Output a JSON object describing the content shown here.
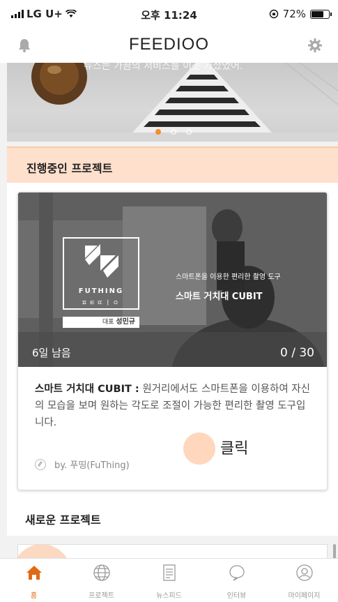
{
  "status_bar": {
    "carrier": "LG U+",
    "time": "오후 11:24",
    "battery_text": "72%",
    "battery_level": 0.72
  },
  "header": {
    "title": "FEEDIOO",
    "left_icon": "bell-icon",
    "right_icon": "gear-icon"
  },
  "banner": {
    "caption": "뉴스는 가끔의 서비스를 이곳 가셨었어.",
    "slide_count": 3,
    "active_slide": 0
  },
  "sections": {
    "ongoing_title": "진행중인 프로젝트",
    "new_title": "새로운 프로젝트"
  },
  "project_card": {
    "logo_name": "FUTHING",
    "logo_sub": "ㅍㅌㄸㅣㅇ",
    "ceo_label": "대표",
    "ceo_name": "성민규",
    "image_subtitle": "스마트폰을 이용한 편리한 촬영 도구",
    "image_title": "스마트 거치대 CUBIT",
    "days_left": "6일 남음",
    "progress": "0 / 30",
    "desc_title": "스마트 거치대 CUBIT :",
    "desc_body": " 원거리에서도 스마트폰을 이용하여 자신의 모습을 보며 원하는 각도로 조절이 가능한 편리한 촬영 도구입니다.",
    "author": "by. 푸띵(FuThing)"
  },
  "annotation": {
    "click_label": "클릭"
  },
  "tabs": [
    {
      "label": "홈",
      "icon": "home-icon",
      "active": true
    },
    {
      "label": "프로젝트",
      "icon": "globe-icon",
      "active": false
    },
    {
      "label": "뉴스피드",
      "icon": "document-icon",
      "active": false
    },
    {
      "label": "인터뷰",
      "icon": "chat-bubble-icon",
      "active": false
    },
    {
      "label": "마이페이지",
      "icon": "profile-icon",
      "active": false
    }
  ]
}
